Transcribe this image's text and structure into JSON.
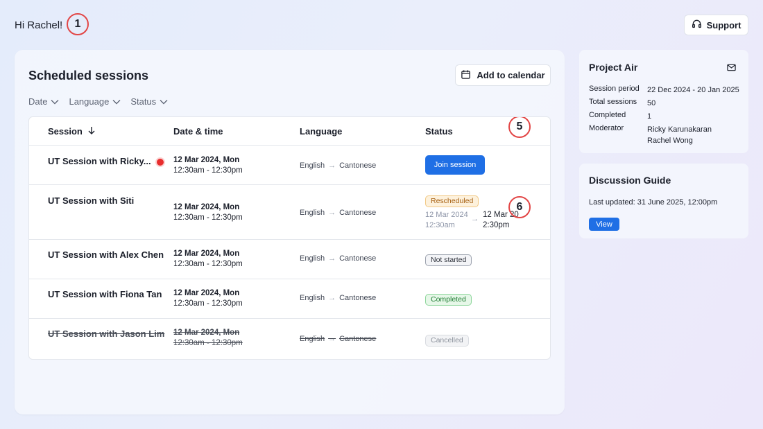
{
  "greeting": "Hi Rachel!",
  "markers": [
    "1",
    "5",
    "6"
  ],
  "support_label": "Support",
  "main": {
    "title": "Scheduled sessions",
    "add_calendar_label": "Add to calendar",
    "filters": [
      "Date",
      "Language",
      "Status"
    ],
    "columns": [
      "Session",
      "Date & time",
      "Language",
      "Status"
    ],
    "rows": [
      {
        "session": "UT Session with Ricky...",
        "date": "12 Mar 2024, Mon",
        "time": "12:30am - 12:30pm",
        "lang_from": "English",
        "lang_to": "Cantonese",
        "status": "Join session",
        "live": true
      },
      {
        "session": "UT Session with Siti",
        "date": "12 Mar 2024, Mon",
        "time": "12:30am - 12:30pm",
        "lang_from": "English",
        "lang_to": "Cantonese",
        "status": "Rescheduled",
        "old_date": "12 Mar 2024",
        "old_time": "12:30am",
        "new_date": "12 Mar 20",
        "new_time": "2:30pm"
      },
      {
        "session": "UT Session with Alex Chen",
        "date": "12 Mar 2024, Mon",
        "time": "12:30am - 12:30pm",
        "lang_from": "English",
        "lang_to": "Cantonese",
        "status": "Not started"
      },
      {
        "session": "UT Session with Fiona Tan",
        "date": "12 Mar 2024, Mon",
        "time": "12:30am - 12:30pm",
        "lang_from": "English",
        "lang_to": "Cantonese",
        "status": "Completed"
      },
      {
        "session": "UT Session with Jason Lim",
        "date": "12 Mar 2024, Mon",
        "time": "12:30am - 12:30pm",
        "lang_from": "English",
        "lang_to": "Cantonese",
        "status": "Cancelled"
      }
    ]
  },
  "project": {
    "title": "Project Air",
    "fields": [
      {
        "label": "Session period",
        "value": "22 Dec 2024 - 20 Jan 2025"
      },
      {
        "label": "Total sessions",
        "value": "50"
      },
      {
        "label": "Completed",
        "value": "1"
      },
      {
        "label": "Moderator",
        "value": "Ricky Karunakaran",
        "value2": "Rachel Wong"
      }
    ]
  },
  "guide": {
    "title": "Discussion Guide",
    "last_updated": "Last updated: 31 June 2025, 12:00pm",
    "view_label": "View"
  },
  "colors": {
    "accent": "#1f6fe5",
    "marker": "#e24646"
  }
}
